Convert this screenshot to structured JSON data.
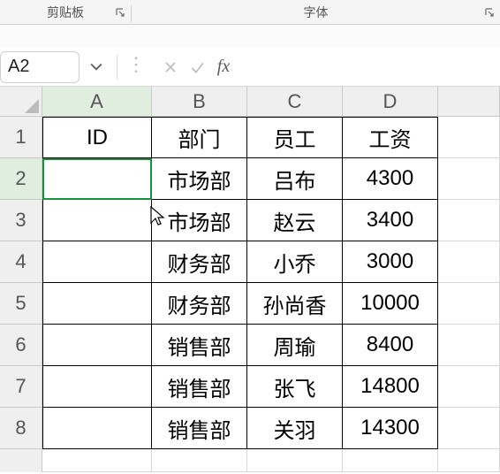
{
  "ribbon": {
    "groups": [
      {
        "label": "剪贴板"
      },
      {
        "label": "字体"
      }
    ]
  },
  "name_box": {
    "value": "A2"
  },
  "formula_bar": {
    "value": ""
  },
  "column_headers": [
    "A",
    "B",
    "C",
    "D"
  ],
  "row_headers": [
    "1",
    "2",
    "3",
    "4",
    "5",
    "6",
    "7",
    "8"
  ],
  "grid": {
    "header_row": {
      "A": "ID",
      "B": "部门",
      "C": "员工",
      "D": "工资"
    },
    "rows": [
      {
        "A": "",
        "B": "市场部",
        "C": "吕布",
        "D": "4300"
      },
      {
        "A": "",
        "B": "市场部",
        "C": "赵云",
        "D": "3400"
      },
      {
        "A": "",
        "B": "财务部",
        "C": "小乔",
        "D": "3000"
      },
      {
        "A": "",
        "B": "财务部",
        "C": "孙尚香",
        "D": "10000"
      },
      {
        "A": "",
        "B": "销售部",
        "C": "周瑜",
        "D": "8400"
      },
      {
        "A": "",
        "B": "销售部",
        "C": "张飞",
        "D": "14800"
      },
      {
        "A": "",
        "B": "销售部",
        "C": "关羽",
        "D": "14300"
      }
    ]
  },
  "icons": {
    "fx": "fx"
  },
  "active_cell": "A2"
}
